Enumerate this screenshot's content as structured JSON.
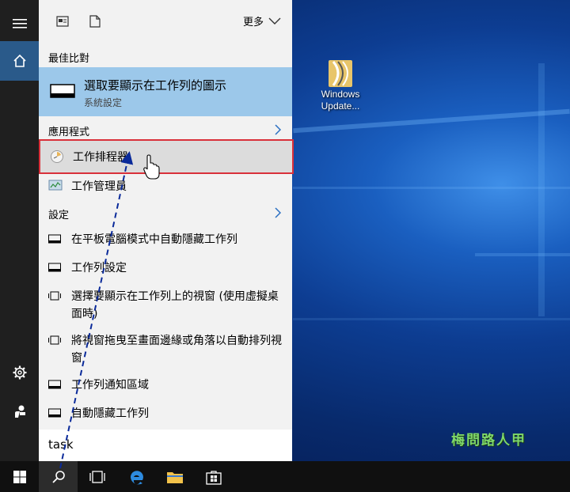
{
  "start_panel": {
    "more_label": "更多",
    "best_match_header": "最佳比對",
    "best_match": {
      "title": "選取要顯示在工作列的圖示",
      "subtitle": "系統設定"
    },
    "apps_header": "應用程式",
    "apps": [
      {
        "label": "工作排程器",
        "icon": "task-scheduler-icon"
      },
      {
        "label": "工作管理員",
        "icon": "task-manager-icon"
      }
    ],
    "settings_header": "設定",
    "settings": [
      {
        "label": "在平板電腦模式中自動隱藏工作列"
      },
      {
        "label": "工作列設定"
      },
      {
        "label": "選擇要顯示在工作列上的視窗 (使用虛擬桌面時)"
      },
      {
        "label": "將視窗拖曳至畫面邊緣或角落以自動排列視窗"
      },
      {
        "label": "工作列通知區域"
      },
      {
        "label": "自動隱藏工作列"
      }
    ],
    "search_query": "task"
  },
  "desktop": {
    "icon_label_line1": "Windows",
    "icon_label_line2": "Update...",
    "watermark": "梅問路人甲"
  },
  "colors": {
    "accent": "#2a5a8a",
    "selection": "#9cc8ea",
    "highlight_border": "#d9303a"
  }
}
